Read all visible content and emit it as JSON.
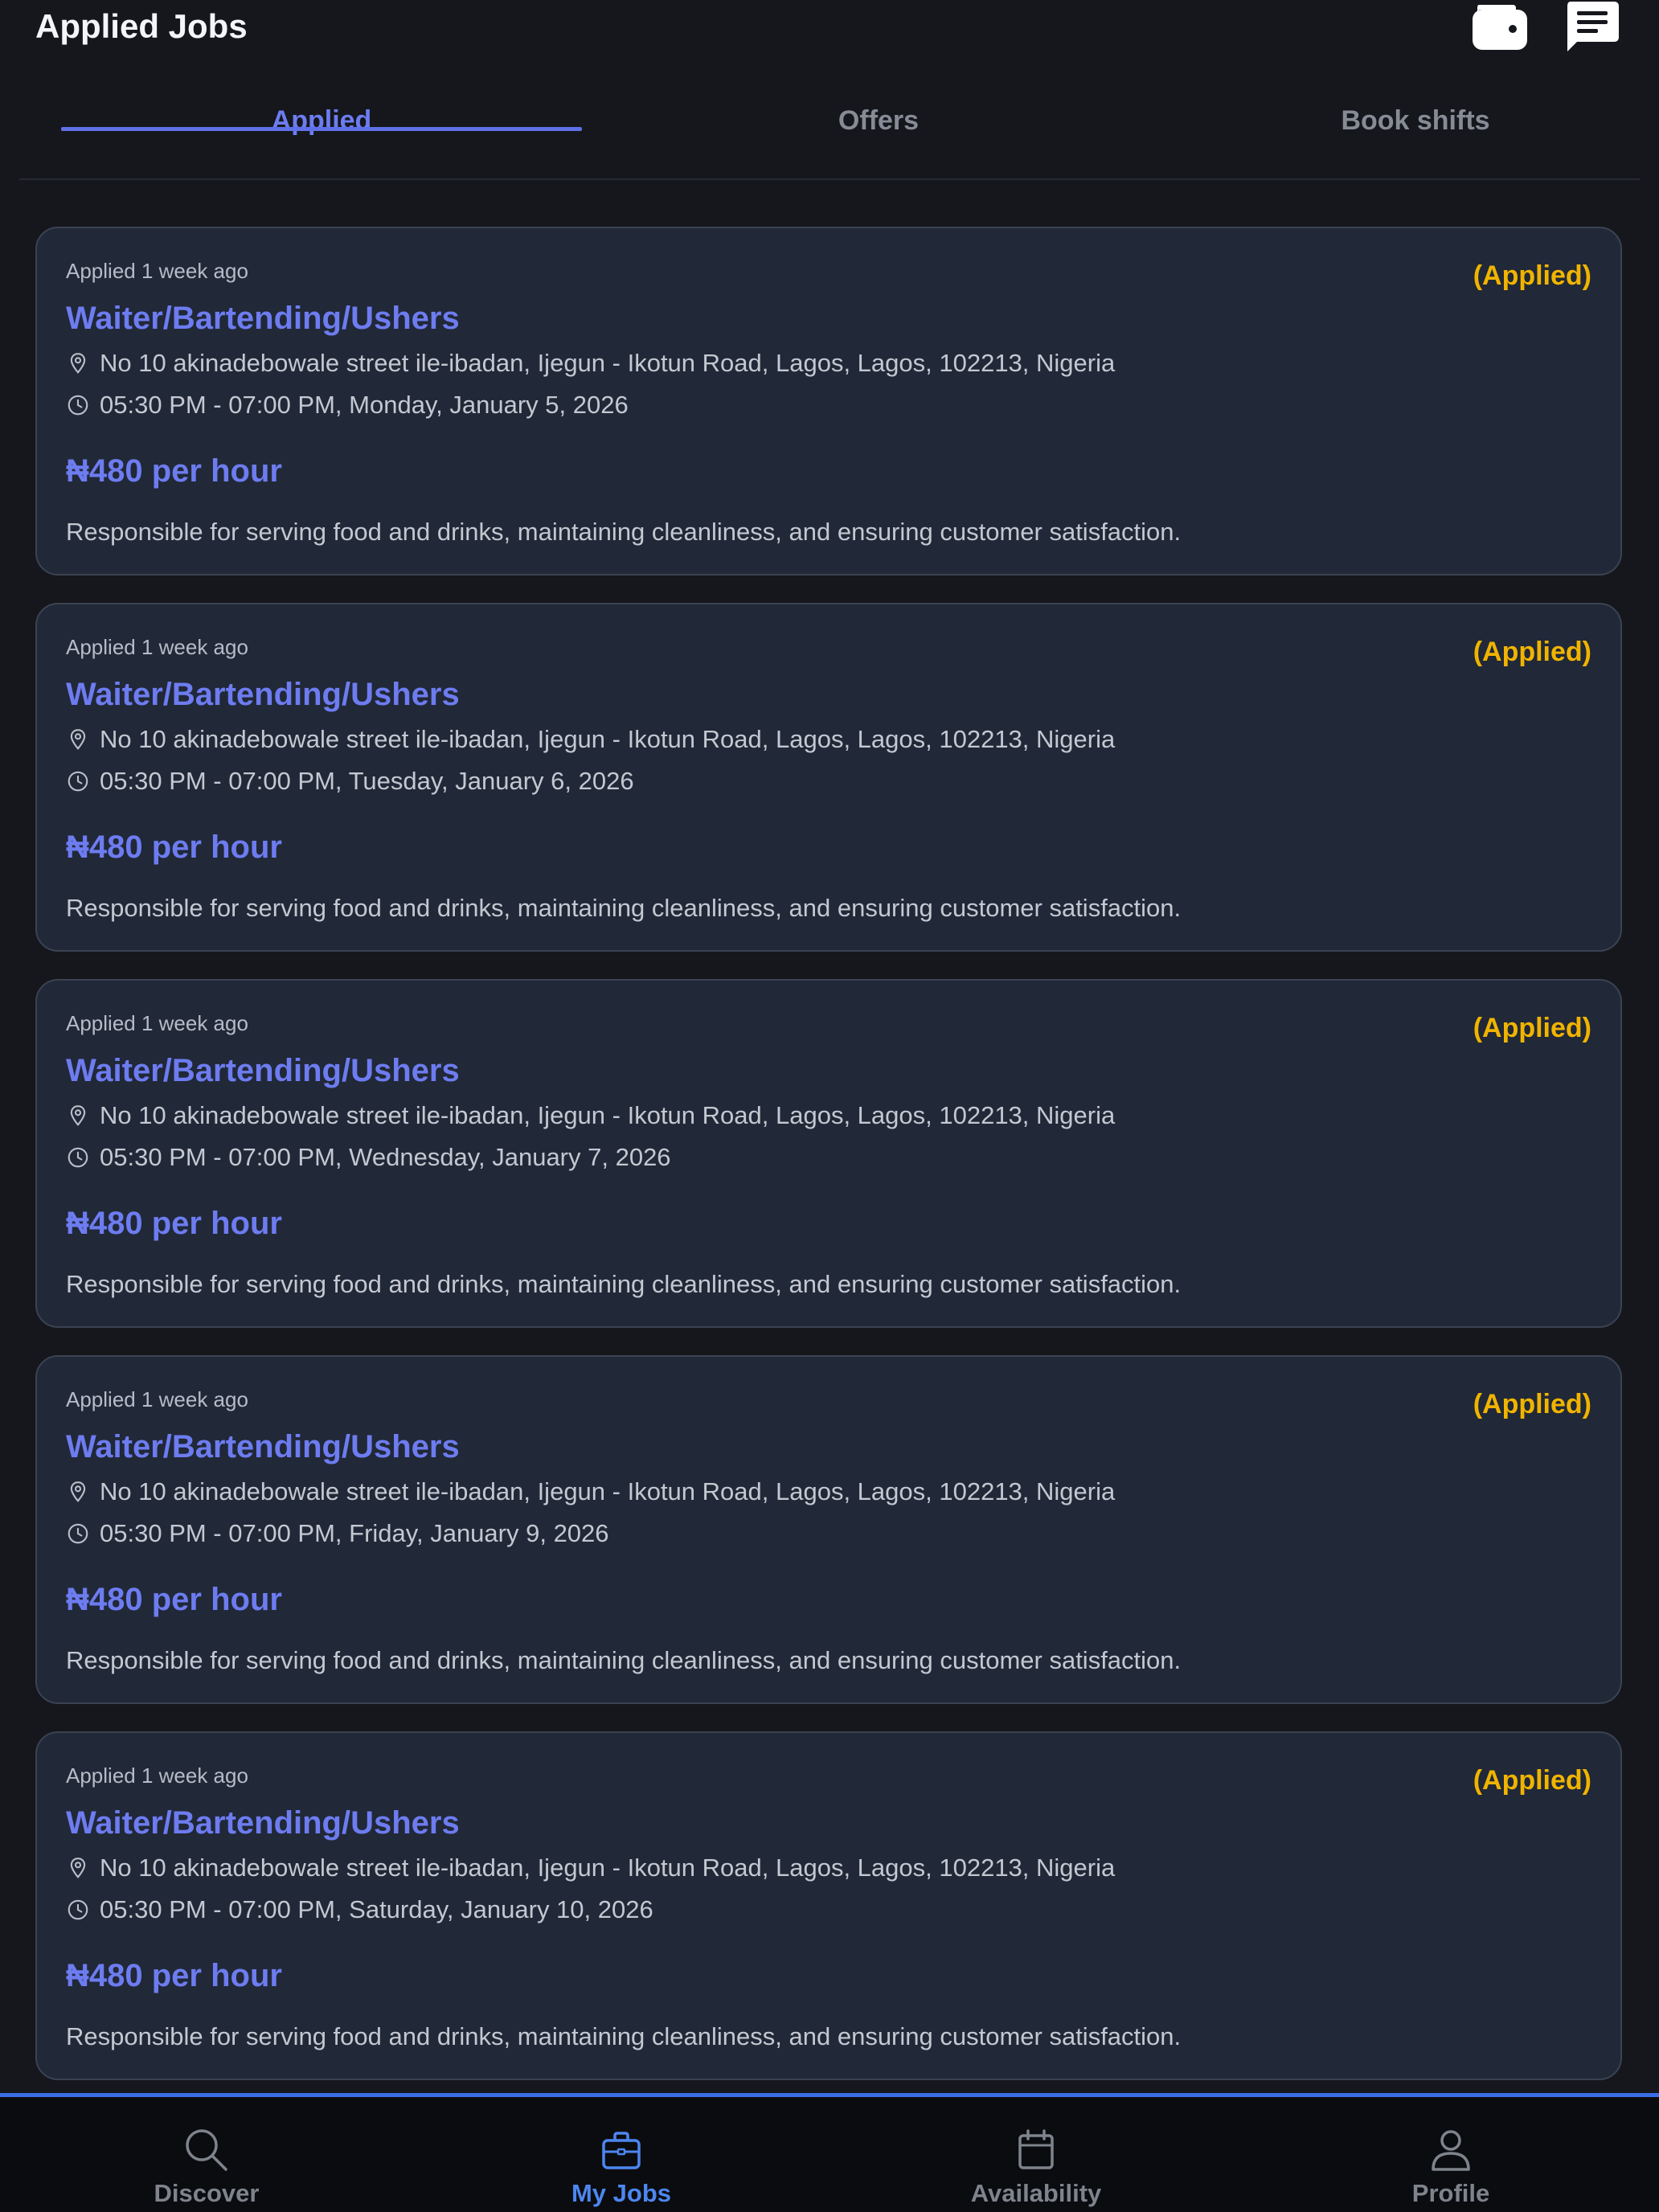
{
  "header": {
    "title": "Applied Jobs",
    "wallet_icon": "wallet-icon",
    "chat_icon": "message-icon"
  },
  "tabs": [
    {
      "label": "Applied",
      "active": true
    },
    {
      "label": "Offers",
      "active": false
    },
    {
      "label": "Book shifts",
      "active": false
    }
  ],
  "jobs": [
    {
      "applied": "Applied 1 week ago",
      "status": "(Applied)",
      "title": "Waiter/Bartending/Ushers",
      "address": "No 10 akinadebowale street ile-ibadan, Ijegun - Ikotun Road, Lagos, Lagos, 102213, Nigeria",
      "time": "05:30 PM - 07:00 PM, Monday, January 5, 2026",
      "rate": "₦480 per hour",
      "description": "Responsible for serving food and drinks, maintaining cleanliness, and ensuring customer satisfaction."
    },
    {
      "applied": "Applied 1 week ago",
      "status": "(Applied)",
      "title": "Waiter/Bartending/Ushers",
      "address": "No 10 akinadebowale street ile-ibadan, Ijegun - Ikotun Road, Lagos, Lagos, 102213, Nigeria",
      "time": "05:30 PM - 07:00 PM, Tuesday, January 6, 2026",
      "rate": "₦480 per hour",
      "description": "Responsible for serving food and drinks, maintaining cleanliness, and ensuring customer satisfaction."
    },
    {
      "applied": "Applied 1 week ago",
      "status": "(Applied)",
      "title": "Waiter/Bartending/Ushers",
      "address": "No 10 akinadebowale street ile-ibadan, Ijegun - Ikotun Road, Lagos, Lagos, 102213, Nigeria",
      "time": "05:30 PM - 07:00 PM, Wednesday, January 7, 2026",
      "rate": "₦480 per hour",
      "description": "Responsible for serving food and drinks, maintaining cleanliness, and ensuring customer satisfaction."
    },
    {
      "applied": "Applied 1 week ago",
      "status": "(Applied)",
      "title": "Waiter/Bartending/Ushers",
      "address": "No 10 akinadebowale street ile-ibadan, Ijegun - Ikotun Road, Lagos, Lagos, 102213, Nigeria",
      "time": "05:30 PM - 07:00 PM, Friday, January 9, 2026",
      "rate": "₦480 per hour",
      "description": "Responsible for serving food and drinks, maintaining cleanliness, and ensuring customer satisfaction."
    },
    {
      "applied": "Applied 1 week ago",
      "status": "(Applied)",
      "title": "Waiter/Bartending/Ushers",
      "address": "No 10 akinadebowale street ile-ibadan, Ijegun - Ikotun Road, Lagos, Lagos, 102213, Nigeria",
      "time": "05:30 PM - 07:00 PM, Saturday, January 10, 2026",
      "rate": "₦480 per hour",
      "description": "Responsible for serving food and drinks, maintaining cleanliness, and ensuring customer satisfaction."
    }
  ],
  "bottom_nav": [
    {
      "label": "Discover",
      "icon": "search-icon",
      "active": false
    },
    {
      "label": "My Jobs",
      "icon": "briefcase-icon",
      "active": true
    },
    {
      "label": "Availability",
      "icon": "calendar-icon",
      "active": false
    },
    {
      "label": "Profile",
      "icon": "user-icon",
      "active": false
    }
  ],
  "colors": {
    "background": "#15171c",
    "card": "#212837",
    "accent": "#6d7cf0",
    "status": "#f0b400",
    "nav_active": "#4d86f0"
  }
}
